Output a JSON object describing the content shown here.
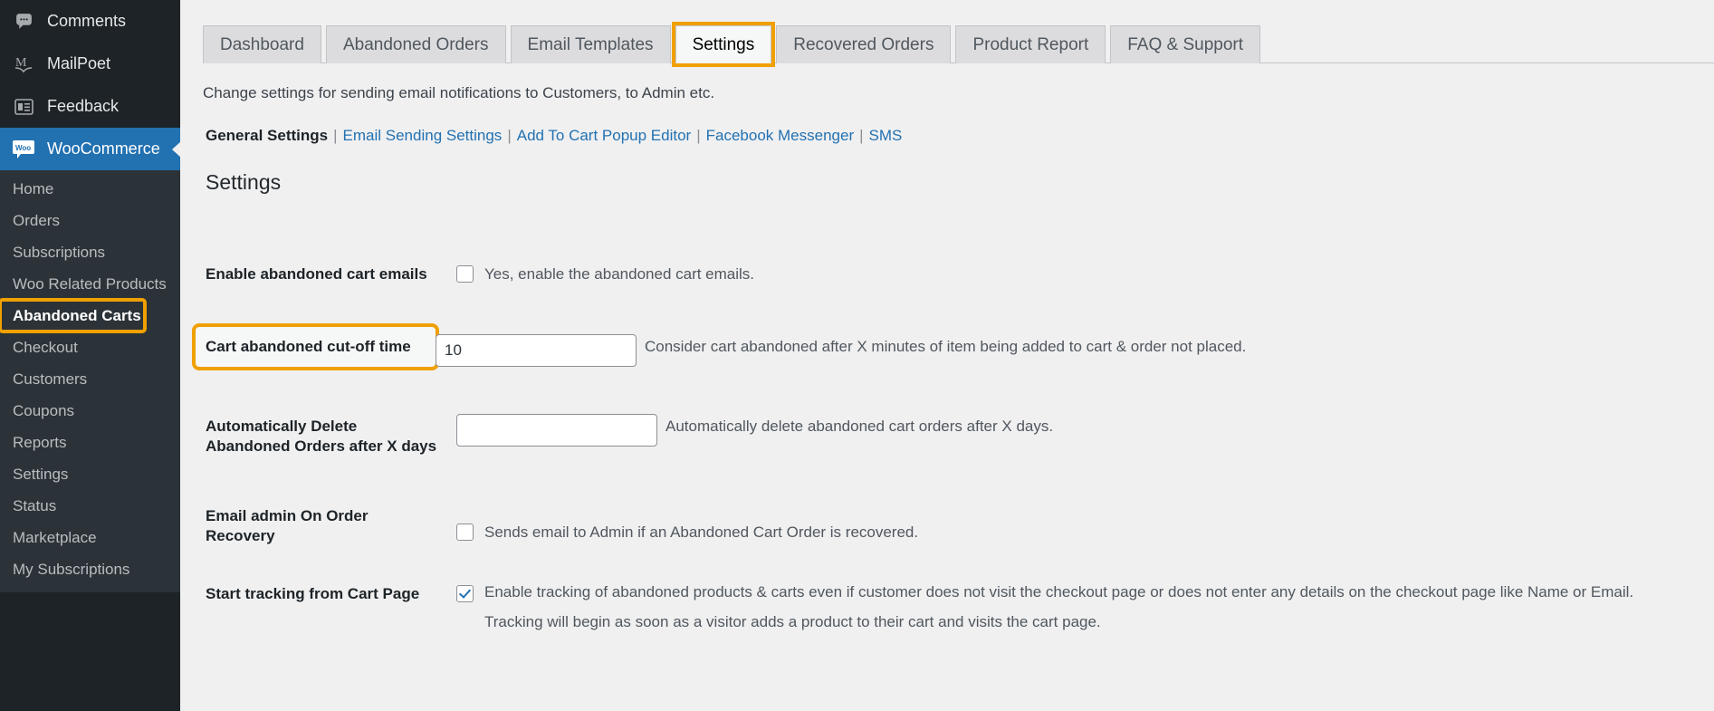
{
  "sidebar": {
    "top_items": [
      {
        "label": "Comments",
        "icon": "comments-icon"
      },
      {
        "label": "MailPoet",
        "icon": "mailpoet-icon"
      },
      {
        "label": "Feedback",
        "icon": "feedback-icon"
      }
    ],
    "current_item": {
      "label": "WooCommerce",
      "icon": "woocommerce-icon"
    },
    "submenu": [
      {
        "label": "Home",
        "state": "normal"
      },
      {
        "label": "Orders",
        "state": "normal"
      },
      {
        "label": "Subscriptions",
        "state": "normal"
      },
      {
        "label": "Woo Related Products",
        "state": "normal"
      },
      {
        "label": "Abandoned Carts",
        "state": "current-highlighted"
      },
      {
        "label": "Checkout",
        "state": "normal"
      },
      {
        "label": "Customers",
        "state": "normal"
      },
      {
        "label": "Coupons",
        "state": "normal"
      },
      {
        "label": "Reports",
        "state": "normal"
      },
      {
        "label": "Settings",
        "state": "normal"
      },
      {
        "label": "Status",
        "state": "normal"
      },
      {
        "label": "Marketplace",
        "state": "normal"
      },
      {
        "label": "My Subscriptions",
        "state": "normal"
      }
    ]
  },
  "tabs": [
    {
      "label": "Dashboard",
      "active": false,
      "highlighted": false
    },
    {
      "label": "Abandoned Orders",
      "active": false,
      "highlighted": false
    },
    {
      "label": "Email Templates",
      "active": false,
      "highlighted": false
    },
    {
      "label": "Settings",
      "active": true,
      "highlighted": true
    },
    {
      "label": "Recovered Orders",
      "active": false,
      "highlighted": false
    },
    {
      "label": "Product Report",
      "active": false,
      "highlighted": false
    },
    {
      "label": "FAQ & Support",
      "active": false,
      "highlighted": false
    }
  ],
  "page": {
    "subtitle": "Change settings for sending email notifications to Customers, to Admin etc.",
    "section_title": "Settings"
  },
  "subnav": [
    {
      "label": "General Settings",
      "current": true
    },
    {
      "label": "Email Sending Settings",
      "current": false
    },
    {
      "label": "Add To Cart Popup Editor",
      "current": false
    },
    {
      "label": "Facebook Messenger",
      "current": false
    },
    {
      "label": "SMS",
      "current": false
    }
  ],
  "settings_rows": [
    {
      "label": "Enable abandoned cart emails",
      "type": "checkbox",
      "checked": false,
      "description": "Yes, enable the abandoned cart emails.",
      "highlighted": false
    },
    {
      "label": "Cart abandoned cut-off time",
      "type": "text",
      "value": "10",
      "placeholder": "",
      "description": "Consider cart abandoned after X minutes of item being added to cart & order not placed.",
      "highlighted": true
    },
    {
      "label": "Automatically Delete Abandoned Orders after X days",
      "type": "text",
      "value": "",
      "placeholder": "",
      "description": "Automatically delete abandoned cart orders after X days.",
      "highlighted": false
    },
    {
      "label": "Email admin On Order Recovery",
      "type": "checkbox",
      "checked": false,
      "description": "Sends email to Admin if an Abandoned Cart Order is recovered.",
      "highlighted": false
    },
    {
      "label": "Start tracking from Cart Page",
      "type": "checkbox",
      "checked": true,
      "description": "Enable tracking of abandoned products & carts even if customer does not visit the checkout page or does not enter any details on the checkout page like Name or Email. Tracking will begin as soon as a visitor adds a product to their cart and visits the cart page.",
      "highlighted": false
    }
  ],
  "colors": {
    "sidebar_bg": "#1d2327",
    "submenu_bg": "#2c3338",
    "accent_blue": "#2271b1",
    "highlight_orange": "#f0a000",
    "content_bg": "#f0f0f1"
  }
}
